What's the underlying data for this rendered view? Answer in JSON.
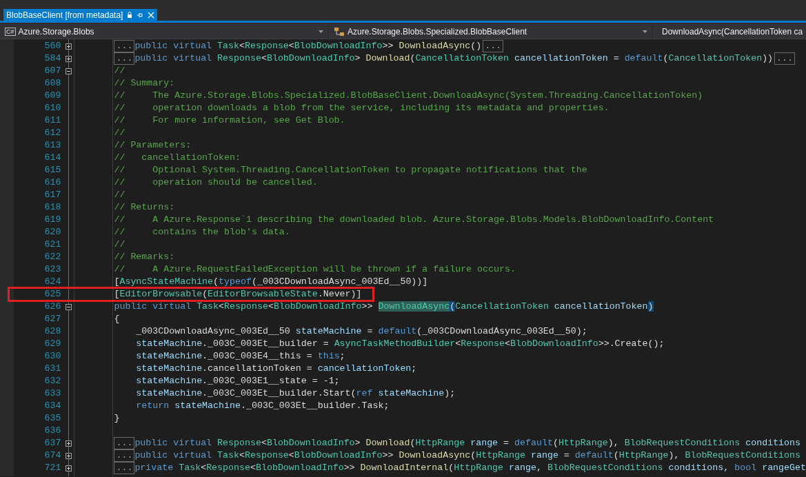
{
  "tab": {
    "title": "BlobBaseClient [from metadata]",
    "selected": true
  },
  "navigation": [
    {
      "kind": "project",
      "badge": "C#",
      "label": "Azure.Storage.Blobs"
    },
    {
      "kind": "class",
      "label": "Azure.Storage.Blobs.Specialized.BlobBaseClient"
    },
    {
      "kind": "member",
      "label": "DownloadAsync(CancellationToken ca"
    }
  ],
  "lines": [
    {
      "number": "560",
      "expanded": false,
      "highlighted": false,
      "lead": "...",
      "tail": "...",
      "tokens": [
        {
          "kind": "kw",
          "text": "public virtual "
        },
        {
          "kind": "type",
          "text": "Task"
        },
        {
          "kind": "plain",
          "text": "<"
        },
        {
          "kind": "type",
          "text": "Response"
        },
        {
          "kind": "plain",
          "text": "<"
        },
        {
          "kind": "type",
          "text": "BlobDownloadInfo"
        },
        {
          "kind": "plain",
          "text": ">> "
        },
        {
          "kind": "method",
          "text": "DownloadAsync"
        },
        {
          "kind": "plain",
          "text": "()"
        }
      ]
    },
    {
      "number": "584",
      "expanded": false,
      "highlighted": false,
      "lead": "...",
      "tail": "...",
      "tokens": [
        {
          "kind": "kw",
          "text": "public virtual "
        },
        {
          "kind": "type",
          "text": "Response"
        },
        {
          "kind": "plain",
          "text": "<"
        },
        {
          "kind": "type",
          "text": "BlobDownloadInfo"
        },
        {
          "kind": "plain",
          "text": "> "
        },
        {
          "kind": "method",
          "text": "Download"
        },
        {
          "kind": "plain",
          "text": "("
        },
        {
          "kind": "type",
          "text": "CancellationToken "
        },
        {
          "kind": "param",
          "text": "cancellationToken"
        },
        {
          "kind": "plain",
          "text": " = "
        },
        {
          "kind": "kw",
          "text": "default"
        },
        {
          "kind": "plain",
          "text": "("
        },
        {
          "kind": "type",
          "text": "CancellationToken"
        },
        {
          "kind": "plain",
          "text": "))"
        }
      ]
    },
    {
      "number": "607",
      "expanded": true,
      "highlighted": false,
      "tokens": [
        {
          "kind": "comment",
          "text": "//"
        }
      ]
    },
    {
      "number": "608",
      "highlighted": false,
      "tokens": [
        {
          "kind": "comment",
          "text": "// Summary:"
        }
      ]
    },
    {
      "number": "609",
      "highlighted": false,
      "tokens": [
        {
          "kind": "comment",
          "text": "//     The Azure.Storage.Blobs.Specialized.BlobBaseClient.DownloadAsync(System.Threading.CancellationToken)"
        }
      ]
    },
    {
      "number": "610",
      "highlighted": false,
      "tokens": [
        {
          "kind": "comment",
          "text": "//     operation downloads a blob from the service, including its metadata and properties."
        }
      ]
    },
    {
      "number": "611",
      "highlighted": false,
      "tokens": [
        {
          "kind": "comment",
          "text": "//     For more information, see Get Blob."
        }
      ]
    },
    {
      "number": "612",
      "highlighted": false,
      "tokens": [
        {
          "kind": "comment",
          "text": "//"
        }
      ]
    },
    {
      "number": "613",
      "highlighted": false,
      "tokens": [
        {
          "kind": "comment",
          "text": "// Parameters:"
        }
      ]
    },
    {
      "number": "614",
      "highlighted": false,
      "tokens": [
        {
          "kind": "comment",
          "text": "//   cancellationToken:"
        }
      ]
    },
    {
      "number": "615",
      "highlighted": false,
      "tokens": [
        {
          "kind": "comment",
          "text": "//     Optional System.Threading.CancellationToken to propagate notifications that the"
        }
      ]
    },
    {
      "number": "616",
      "highlighted": false,
      "tokens": [
        {
          "kind": "comment",
          "text": "//     operation should be cancelled."
        }
      ]
    },
    {
      "number": "617",
      "highlighted": false,
      "tokens": [
        {
          "kind": "comment",
          "text": "//"
        }
      ]
    },
    {
      "number": "618",
      "highlighted": false,
      "tokens": [
        {
          "kind": "comment",
          "text": "// Returns:"
        }
      ]
    },
    {
      "number": "619",
      "highlighted": false,
      "tokens": [
        {
          "kind": "comment",
          "text": "//     A Azure.Response`1 describing the downloaded blob. Azure.Storage.Blobs.Models.BlobDownloadInfo.Content"
        }
      ]
    },
    {
      "number": "620",
      "highlighted": false,
      "tokens": [
        {
          "kind": "comment",
          "text": "//     contains the blob's data."
        }
      ]
    },
    {
      "number": "621",
      "highlighted": false,
      "tokens": [
        {
          "kind": "comment",
          "text": "//"
        }
      ]
    },
    {
      "number": "622",
      "highlighted": false,
      "tokens": [
        {
          "kind": "comment",
          "text": "// Remarks:"
        }
      ]
    },
    {
      "number": "623",
      "highlighted": false,
      "tokens": [
        {
          "kind": "comment",
          "text": "//     A Azure.RequestFailedException will be thrown if a failure occurs."
        }
      ]
    },
    {
      "number": "624",
      "highlighted": false,
      "tokens": [
        {
          "kind": "plain",
          "text": "["
        },
        {
          "kind": "type",
          "text": "AsyncStateMachine"
        },
        {
          "kind": "plain",
          "text": "("
        },
        {
          "kind": "kw",
          "text": "typeof"
        },
        {
          "kind": "plain",
          "text": "(_003CDownloadAsync_003Ed__50))]"
        }
      ]
    },
    {
      "number": "625",
      "highlighted": true,
      "tokens": [
        {
          "kind": "plain",
          "text": "["
        },
        {
          "kind": "type",
          "text": "EditorBrowsable"
        },
        {
          "kind": "plain",
          "text": "("
        },
        {
          "kind": "type",
          "text": "EditorBrowsableState"
        },
        {
          "kind": "plain",
          "text": ".Never)]"
        }
      ]
    },
    {
      "number": "626",
      "expanded": true,
      "highlighted": false,
      "tokens": [
        {
          "kind": "kw",
          "text": "public virtual "
        },
        {
          "kind": "type",
          "text": "Task"
        },
        {
          "kind": "plain",
          "text": "<"
        },
        {
          "kind": "type",
          "text": "Response"
        },
        {
          "kind": "plain",
          "text": "<"
        },
        {
          "kind": "type",
          "text": "BlobDownloadInfo"
        },
        {
          "kind": "plain",
          "text": ">> "
        },
        {
          "kind": "match",
          "text": "DownloadAsync"
        },
        {
          "kind": "brace",
          "text": "("
        },
        {
          "kind": "type",
          "text": "CancellationToken "
        },
        {
          "kind": "param",
          "text": "cancellationToken"
        },
        {
          "kind": "brace",
          "text": ")"
        }
      ]
    },
    {
      "number": "627",
      "highlighted": false,
      "tokens": [
        {
          "kind": "plain",
          "text": "{"
        }
      ]
    },
    {
      "number": "628",
      "highlighted": false,
      "tokens": [
        {
          "kind": "plain",
          "text": "    _003CDownloadAsync_003Ed__50 "
        },
        {
          "kind": "param",
          "text": "stateMachine"
        },
        {
          "kind": "plain",
          "text": " = "
        },
        {
          "kind": "kw",
          "text": "default"
        },
        {
          "kind": "plain",
          "text": "(_003CDownloadAsync_003Ed__50);"
        }
      ]
    },
    {
      "number": "629",
      "highlighted": false,
      "tokens": [
        {
          "kind": "param",
          "text": "    stateMachine"
        },
        {
          "kind": "plain",
          "text": "._003C_003Et__builder = "
        },
        {
          "kind": "type",
          "text": "AsyncTaskMethodBuilder"
        },
        {
          "kind": "plain",
          "text": "<"
        },
        {
          "kind": "type",
          "text": "Response"
        },
        {
          "kind": "plain",
          "text": "<"
        },
        {
          "kind": "type",
          "text": "BlobDownloadInfo"
        },
        {
          "kind": "plain",
          "text": ">>.Create();"
        }
      ]
    },
    {
      "number": "630",
      "highlighted": false,
      "tokens": [
        {
          "kind": "param",
          "text": "    stateMachine"
        },
        {
          "kind": "plain",
          "text": "._003C_003E4__this = "
        },
        {
          "kind": "kw",
          "text": "this"
        },
        {
          "kind": "plain",
          "text": ";"
        }
      ]
    },
    {
      "number": "631",
      "highlighted": false,
      "tokens": [
        {
          "kind": "param",
          "text": "    stateMachine"
        },
        {
          "kind": "plain",
          "text": ".cancellationToken = "
        },
        {
          "kind": "param",
          "text": "cancellationToken"
        },
        {
          "kind": "plain",
          "text": ";"
        }
      ]
    },
    {
      "number": "632",
      "highlighted": false,
      "tokens": [
        {
          "kind": "param",
          "text": "    stateMachine"
        },
        {
          "kind": "plain",
          "text": "._003C_003E1__state = -1;"
        }
      ]
    },
    {
      "number": "633",
      "highlighted": false,
      "tokens": [
        {
          "kind": "param",
          "text": "    stateMachine"
        },
        {
          "kind": "plain",
          "text": "._003C_003Et__builder.Start("
        },
        {
          "kind": "kw",
          "text": "ref "
        },
        {
          "kind": "param",
          "text": "stateMachine"
        },
        {
          "kind": "plain",
          "text": ");"
        }
      ]
    },
    {
      "number": "634",
      "highlighted": false,
      "tokens": [
        {
          "kind": "kw",
          "text": "    return "
        },
        {
          "kind": "param",
          "text": "stateMachine"
        },
        {
          "kind": "plain",
          "text": "._003C_003Et__builder.Task;"
        }
      ]
    },
    {
      "number": "635",
      "highlighted": false,
      "tokens": [
        {
          "kind": "plain",
          "text": "}"
        }
      ]
    },
    {
      "number": "636",
      "highlighted": false
    },
    {
      "number": "637",
      "expanded": false,
      "highlighted": false,
      "lead": "...",
      "tokens": [
        {
          "kind": "kw",
          "text": "public virtual "
        },
        {
          "kind": "type",
          "text": "Response"
        },
        {
          "kind": "plain",
          "text": "<"
        },
        {
          "kind": "type",
          "text": "BlobDownloadInfo"
        },
        {
          "kind": "plain",
          "text": "> "
        },
        {
          "kind": "method",
          "text": "Download"
        },
        {
          "kind": "plain",
          "text": "("
        },
        {
          "kind": "type",
          "text": "HttpRange "
        },
        {
          "kind": "param",
          "text": "range"
        },
        {
          "kind": "plain",
          "text": " = "
        },
        {
          "kind": "kw",
          "text": "default"
        },
        {
          "kind": "plain",
          "text": "("
        },
        {
          "kind": "type",
          "text": "HttpRange"
        },
        {
          "kind": "plain",
          "text": "), "
        },
        {
          "kind": "type",
          "text": "BlobRequestConditions "
        },
        {
          "kind": "param",
          "text": "conditions"
        }
      ]
    },
    {
      "number": "674",
      "expanded": false,
      "highlighted": false,
      "lead": "...",
      "tokens": [
        {
          "kind": "kw",
          "text": "public virtual "
        },
        {
          "kind": "type",
          "text": "Task"
        },
        {
          "kind": "plain",
          "text": "<"
        },
        {
          "kind": "type",
          "text": "Response"
        },
        {
          "kind": "plain",
          "text": "<"
        },
        {
          "kind": "type",
          "text": "BlobDownloadInfo"
        },
        {
          "kind": "plain",
          "text": ">> "
        },
        {
          "kind": "method",
          "text": "DownloadAsync"
        },
        {
          "kind": "plain",
          "text": "("
        },
        {
          "kind": "type",
          "text": "HttpRange "
        },
        {
          "kind": "param",
          "text": "range"
        },
        {
          "kind": "plain",
          "text": " = "
        },
        {
          "kind": "kw",
          "text": "default"
        },
        {
          "kind": "plain",
          "text": "("
        },
        {
          "kind": "type",
          "text": "HttpRange"
        },
        {
          "kind": "plain",
          "text": "), "
        },
        {
          "kind": "type",
          "text": "BlobRequestConditions"
        }
      ]
    },
    {
      "number": "721",
      "expanded": false,
      "highlighted": false,
      "lead": "...",
      "tokens": [
        {
          "kind": "kw",
          "text": "private "
        },
        {
          "kind": "type",
          "text": "Task"
        },
        {
          "kind": "plain",
          "text": "<"
        },
        {
          "kind": "type",
          "text": "Response"
        },
        {
          "kind": "plain",
          "text": "<"
        },
        {
          "kind": "type",
          "text": "BlobDownloadInfo"
        },
        {
          "kind": "plain",
          "text": ">> "
        },
        {
          "kind": "method",
          "text": "DownloadInternal"
        },
        {
          "kind": "plain",
          "text": "("
        },
        {
          "kind": "type",
          "text": "HttpRange "
        },
        {
          "kind": "param",
          "text": "range"
        },
        {
          "kind": "plain",
          "text": ", "
        },
        {
          "kind": "type",
          "text": "BlobRequestConditions "
        },
        {
          "kind": "param",
          "text": "conditions"
        },
        {
          "kind": "plain",
          "text": ", "
        },
        {
          "kind": "kw",
          "text": "bool "
        },
        {
          "kind": "param",
          "text": "rangeGet"
        }
      ]
    }
  ]
}
